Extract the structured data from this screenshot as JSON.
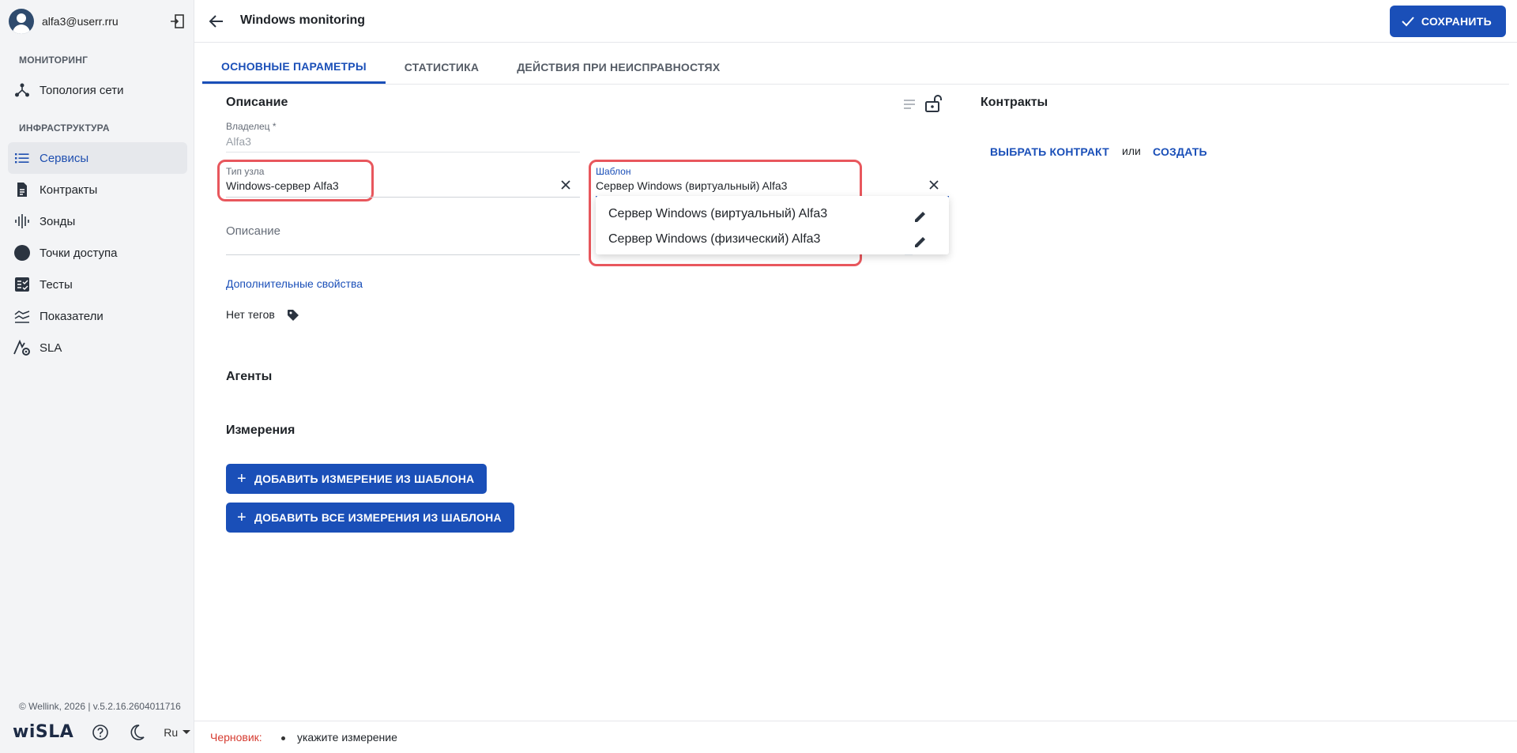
{
  "user": {
    "email": "alfa3@userr.rru"
  },
  "sidebar": {
    "sections": [
      {
        "title": "МОНИТОРИНГ"
      },
      {
        "title": "ИНФРАСТРУКТУРА"
      }
    ],
    "items": [
      {
        "label": "Топология сети",
        "icon": "topology-icon"
      },
      {
        "label": "Сервисы",
        "icon": "list-icon",
        "active": true
      },
      {
        "label": "Контракты",
        "icon": "document-icon"
      },
      {
        "label": "Зонды",
        "icon": "probe-icon"
      },
      {
        "label": "Точки доступа",
        "icon": "circle-icon"
      },
      {
        "label": "Тесты",
        "icon": "checklist-icon"
      },
      {
        "label": "Показатели",
        "icon": "metrics-icon"
      },
      {
        "label": "SLA",
        "icon": "sla-icon"
      }
    ],
    "copyright": "© Wellink, 2026 | v.5.2.16.2604011716",
    "logo": "wiSLA",
    "language": "Ru"
  },
  "header": {
    "title": "Windows monitoring",
    "save_label": "СОХРАНИТЬ"
  },
  "tabs": [
    {
      "label": "ОСНОВНЫЕ ПАРАМЕТРЫ",
      "active": true
    },
    {
      "label": "СТАТИСТИКА"
    },
    {
      "label": "ДЕЙСТВИЯ ПРИ НЕИСПРАВНОСТЯХ"
    }
  ],
  "form": {
    "description_title": "Описание",
    "owner_label": "Владелец *",
    "owner_value": "Alfa3",
    "node_type_label": "Тип узла",
    "node_type_value": "Windows-сервер Alfa3",
    "template_label": "Шаблон",
    "template_value": "Сервер Windows (виртуальный) Alfa3",
    "template_options": [
      "Сервер Windows (виртуальный) Alfa3",
      "Сервер Windows (физический) Alfa3"
    ],
    "description_placeholder": "Описание",
    "extra_props_link": "Дополнительные свойства",
    "no_tags": "Нет тегов",
    "agents_title": "Агенты",
    "measurements_title": "Измерения",
    "add_measurement_btn": "ДОБАВИТЬ ИЗМЕРЕНИЕ ИЗ ШАБЛОНА",
    "add_all_measurements_btn": "ДОБАВИТЬ ВСЕ ИЗМЕРЕНИЯ ИЗ ШАБЛОНА"
  },
  "contracts": {
    "title": "Контракты",
    "choose_label": "ВЫБРАТЬ КОНТРАКТ",
    "or_label": "или",
    "create_label": "СОЗДАТЬ"
  },
  "footer": {
    "draft_label": "Черновик:",
    "message": "укажите измерение"
  },
  "colors": {
    "accent": "#1a4fb8",
    "highlight": "#e8575d",
    "draft": "#d63b30"
  }
}
